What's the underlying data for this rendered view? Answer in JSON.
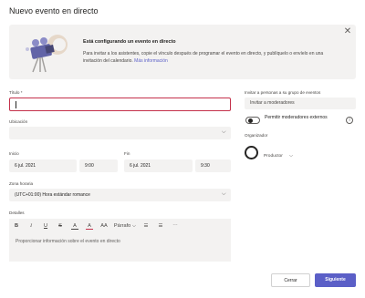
{
  "dialog": {
    "title": "Nuevo evento en directo"
  },
  "banner": {
    "heading": "Está configurando un evento en directo",
    "body": "Para invitar a los asistentes, copie el vínculo después de programar el evento en directo, y publíquelo o envíelo en una invitación del calendario.",
    "link": "Más información"
  },
  "form": {
    "title_label": "Título *",
    "location_label": "Ubicación",
    "start_label": "Inicio",
    "start_date": "6 jul. 2021",
    "start_time": "9:00",
    "end_label": "Fin",
    "end_date": "6 jul. 2021",
    "end_time": "9:30",
    "timezone_label": "Zona horaria",
    "timezone_value": "(UTC+01:00) Hora estándar romance",
    "details_label": "Detalles",
    "details_placeholder": "Proporcionar información sobre el evento en directo"
  },
  "toolbar": {
    "bold": "B",
    "italic": "I",
    "underline": "U",
    "strike": "S",
    "highlight": "A",
    "color": "A",
    "size": "AA",
    "paragraph": "Párrafo ⌵",
    "indent": "☰",
    "outdent": "☰",
    "more": "⋯"
  },
  "right_panel": {
    "invite_label": "Invitar a personas a su grupo de eventos",
    "invite_placeholder": "Invitar a moderadores",
    "toggle_label": "Permitir moderadores externos",
    "info_glyph": "i",
    "organizer_label": "Organizador",
    "role": "Productor",
    "role_caret": "⌵"
  },
  "buttons": {
    "cancel": "Cerrar",
    "next": "Siguiente"
  },
  "glyphs": {
    "close": "✕",
    "caret": "⌵"
  },
  "colors": {
    "accent": "#5b5fc7",
    "error": "#c4314b",
    "field_bg": "#f3f2f1"
  }
}
